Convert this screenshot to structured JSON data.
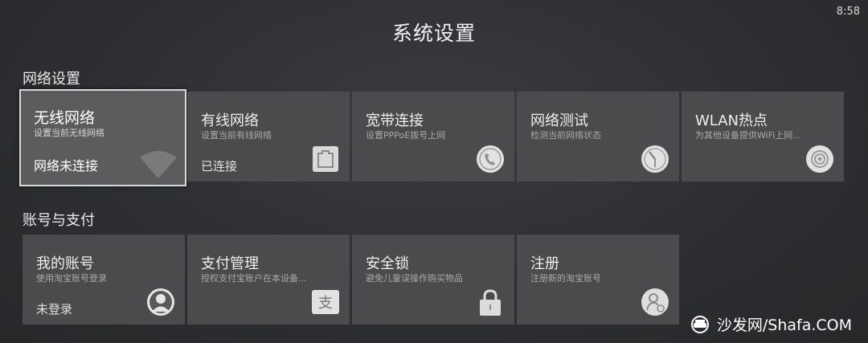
{
  "clock": "8:58",
  "page_title": "系统设置",
  "sections": [
    {
      "title": "网络设置",
      "tiles": [
        {
          "title": "无线网络",
          "subtitle": "设置当前无线网络",
          "status": "网络未连接",
          "icon": "wifi-icon",
          "focused": true
        },
        {
          "title": "有线网络",
          "subtitle": "设置当前有线网络",
          "status": "已连接",
          "icon": "ethernet-icon"
        },
        {
          "title": "宽带连接",
          "subtitle": "设置PPPoE拨号上网",
          "status": "",
          "icon": "phone-icon"
        },
        {
          "title": "网络测试",
          "subtitle": "检测当前网络状态",
          "status": "",
          "icon": "speedometer-icon"
        },
        {
          "title": "WLAN热点",
          "subtitle": "为其他设备提供WiFi上网...",
          "status": "",
          "icon": "hotspot-icon"
        }
      ]
    },
    {
      "title": "账号与支付",
      "tiles": [
        {
          "title": "我的账号",
          "subtitle": "使用淘宝账号登录",
          "status": "未登录",
          "icon": "user-avatar-icon"
        },
        {
          "title": "支付管理",
          "subtitle": "授权支付宝账户在本设备...",
          "status": "",
          "icon": "alipay-icon"
        },
        {
          "title": "安全锁",
          "subtitle": "避免儿童误操作购买物品",
          "status": "",
          "icon": "lock-icon"
        },
        {
          "title": "注册",
          "subtitle": "注册新的淘宝账号",
          "status": "",
          "icon": "register-user-icon"
        }
      ]
    }
  ],
  "watermark": "沙发网/Shafa.COM"
}
